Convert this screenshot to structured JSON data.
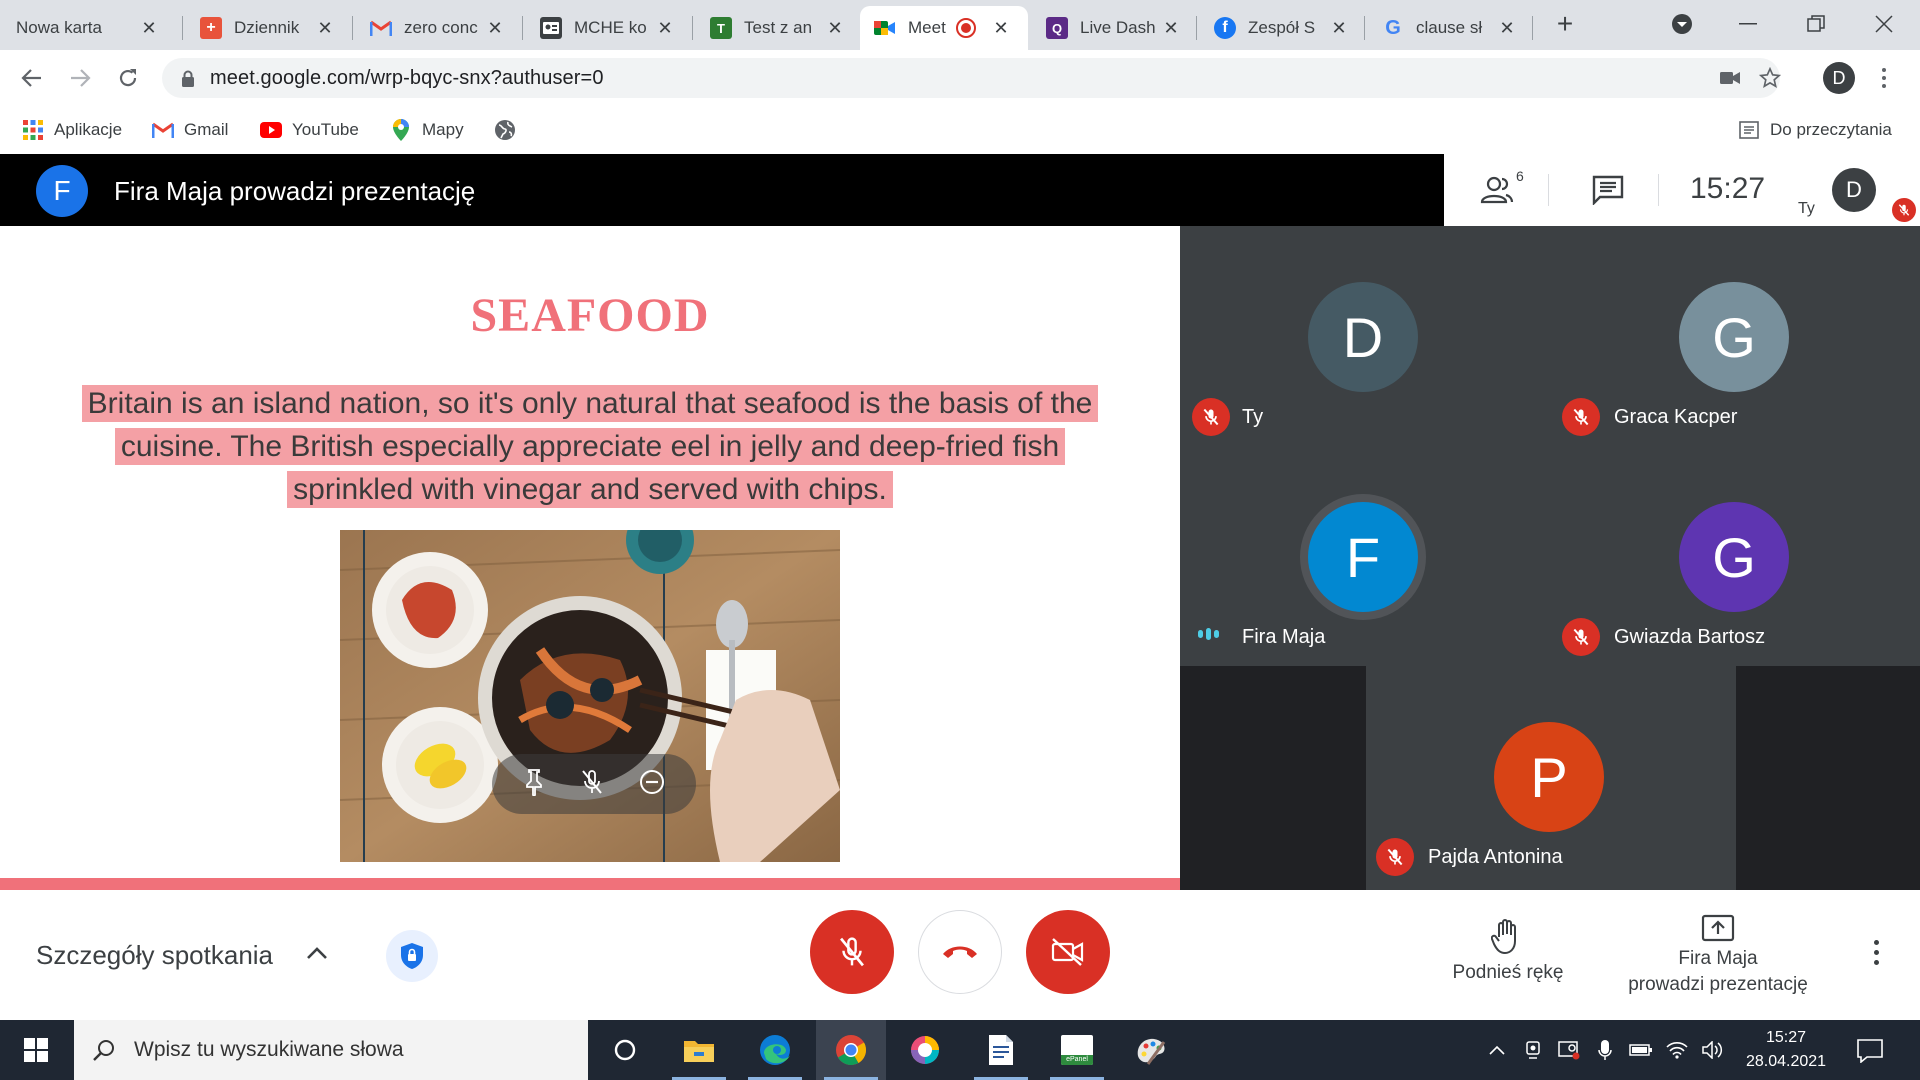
{
  "browser": {
    "tabs": [
      {
        "title": "Nowa karta",
        "icon": "new-tab-icon",
        "color": "#dee1e6"
      },
      {
        "title": "Dziennik",
        "icon": "dziennik-icon",
        "color": "#e8533b"
      },
      {
        "title": "zero conc",
        "icon": "gmail-icon",
        "color": "#ea4335"
      },
      {
        "title": "MCHE ko",
        "icon": "contact-card-icon",
        "color": "#3c4043"
      },
      {
        "title": "Test z an",
        "icon": "testportal-icon",
        "color": "#2e7d32"
      },
      {
        "title": "Meet",
        "icon": "meet-icon",
        "color": "#00832d",
        "active": true
      },
      {
        "title": "Live Dash",
        "icon": "quizizz-icon",
        "color": "#5b2a86"
      },
      {
        "title": "Zespół S",
        "icon": "facebook-icon",
        "color": "#1877f2"
      },
      {
        "title": "clause sł",
        "icon": "google-icon",
        "color": "#4285f4"
      }
    ],
    "url": "meet.google.com/wrp-bqyc-snx?authuser=0",
    "profile_initial": "D",
    "bookmarks": [
      {
        "label": "Aplikacje",
        "icon": "apps-grid-icon"
      },
      {
        "label": "Gmail",
        "icon": "gmail-icon"
      },
      {
        "label": "YouTube",
        "icon": "youtube-icon"
      },
      {
        "label": "Mapy",
        "icon": "maps-pin-icon"
      },
      {
        "label": "",
        "icon": "globe-icon"
      }
    ],
    "reading_list": "Do przeczytania"
  },
  "meet": {
    "presenter_initial": "F",
    "presenter_title": "Fira Maja prowadzi prezentację",
    "participants_count": "6",
    "time": "15:27",
    "self_label": "Ty",
    "self_initial": "D",
    "colors": {
      "accent": "#1a73e8",
      "mute_red": "#d93025",
      "slide_pink": "#f0717a",
      "grid_bg": "#202124"
    }
  },
  "slide": {
    "title": "SEAFOOD",
    "text": "Britain is an island nation, so it's only natural that seafood is the basis of the cuisine. The British especially appreciate eel in jelly and deep-fried fish sprinkled with vinegar and served with chips."
  },
  "participants": [
    {
      "initial": "D",
      "name": "Ty",
      "color": "#455a64",
      "muted": true
    },
    {
      "initial": "G",
      "name": "Graca Kacper",
      "color": "#78909c",
      "muted": true
    },
    {
      "initial": "F",
      "name": "Fira Maja",
      "color": "#0288d1",
      "muted": false,
      "speaking": true
    },
    {
      "initial": "G",
      "name": "Gwiazda Bartosz",
      "color": "#5e35b1",
      "muted": true
    },
    {
      "initial": "P",
      "name": "Pajda Antonina",
      "color": "#d84315",
      "muted": true
    }
  ],
  "controls": {
    "details": "Szczegóły spotkania",
    "raise_hand": "Podnieś rękę",
    "presenting_line1": "Fira Maja",
    "presenting_line2": "prowadzi prezentację"
  },
  "taskbar": {
    "search_placeholder": "Wpisz tu wyszukiwane słowa",
    "time": "15:27",
    "date": "28.04.2021",
    "apps": [
      "task-view-icon",
      "file-explorer-icon",
      "edge-icon",
      "chrome-icon",
      "paint-3d-icon",
      "word-doc-icon",
      "epanel-icon",
      "paint-icon"
    ],
    "epanel_label": "ePanel"
  }
}
